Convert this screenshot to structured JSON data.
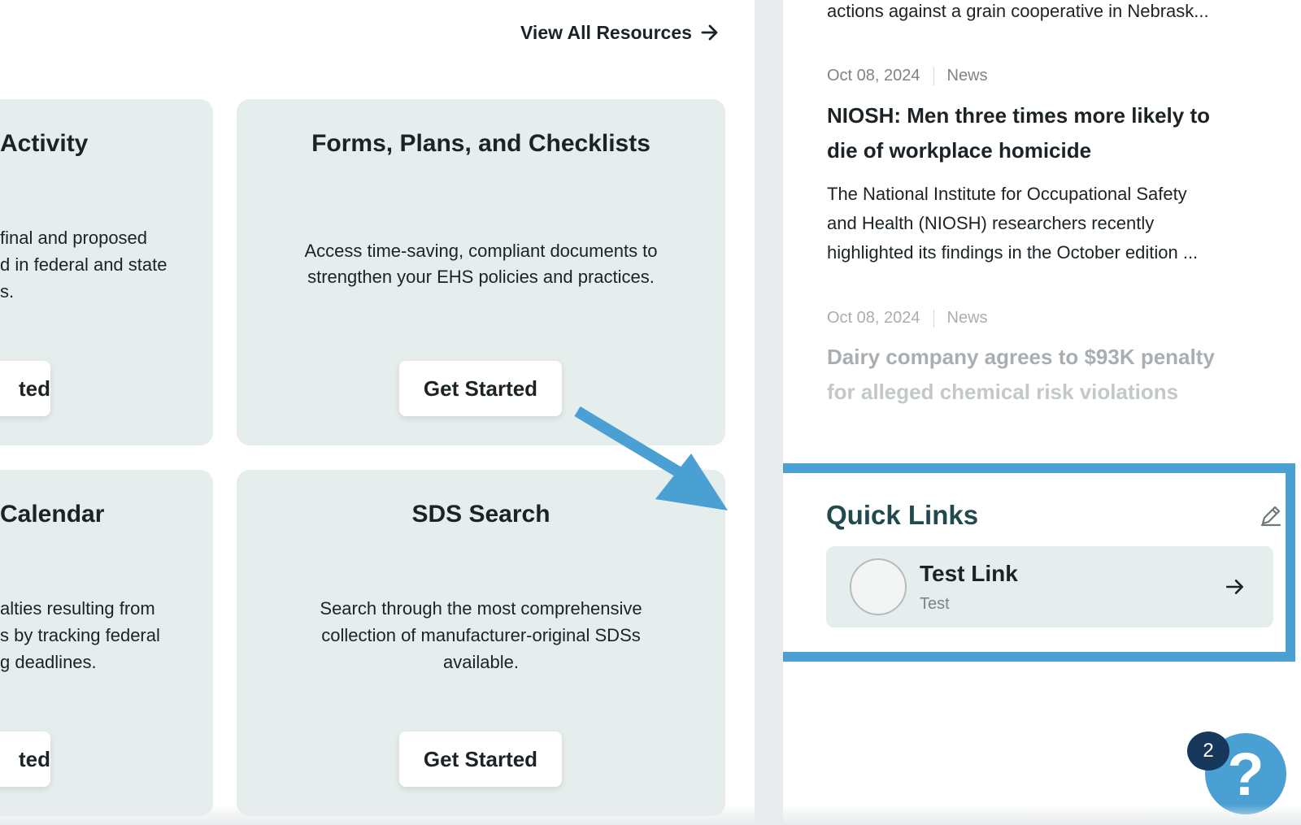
{
  "resources": {
    "view_all": "View All Resources",
    "cards": [
      {
        "title": "Activity",
        "lines": [
          "final and proposed",
          "d in federal and state",
          "s."
        ],
        "button": "ted"
      },
      {
        "title": "Forms, Plans, and Checklists",
        "lines": [
          "Access time-saving, compliant documents to",
          "strengthen your EHS policies and practices."
        ],
        "button": "Get Started"
      },
      {
        "title": "Calendar",
        "lines": [
          "alties resulting from",
          "s by tracking federal",
          "g deadlines."
        ],
        "button": "ted"
      },
      {
        "title": "SDS Search",
        "lines": [
          "Search through the most comprehensive",
          "collection of manufacturer-original SDSs",
          "available."
        ],
        "button": "Get Started"
      }
    ]
  },
  "news": {
    "partial_top": "actions against a grain cooperative in Nebrask...",
    "items": [
      {
        "date": "Oct 08, 2024",
        "category": "News",
        "title_lines": [
          "NIOSH: Men three times more likely to",
          "die of workplace homicide"
        ],
        "body_lines": [
          "The National Institute for Occupational Safety",
          "and Health (NIOSH) researchers recently",
          "highlighted its findings in the October edition ..."
        ]
      },
      {
        "date": "Oct 08, 2024",
        "category": "News",
        "title_lines": [
          "Dairy company agrees to $93K penalty",
          "for alleged chemical risk violations"
        ]
      }
    ]
  },
  "quick_links": {
    "title": "Quick Links",
    "items": [
      {
        "name": "Test Link",
        "subtitle": "Test"
      }
    ]
  },
  "help": {
    "badge_count": "2",
    "label": "?"
  },
  "colors": {
    "highlight": "#4aa0d3",
    "card_bg": "#e6eded",
    "quick_links_title": "#214a4e",
    "badge": "#17375b"
  },
  "icons": {
    "view_all": "arrow-right-icon",
    "edit": "pencil-icon",
    "link_go": "arrow-right-icon",
    "annotation": "arrow-pointer"
  }
}
